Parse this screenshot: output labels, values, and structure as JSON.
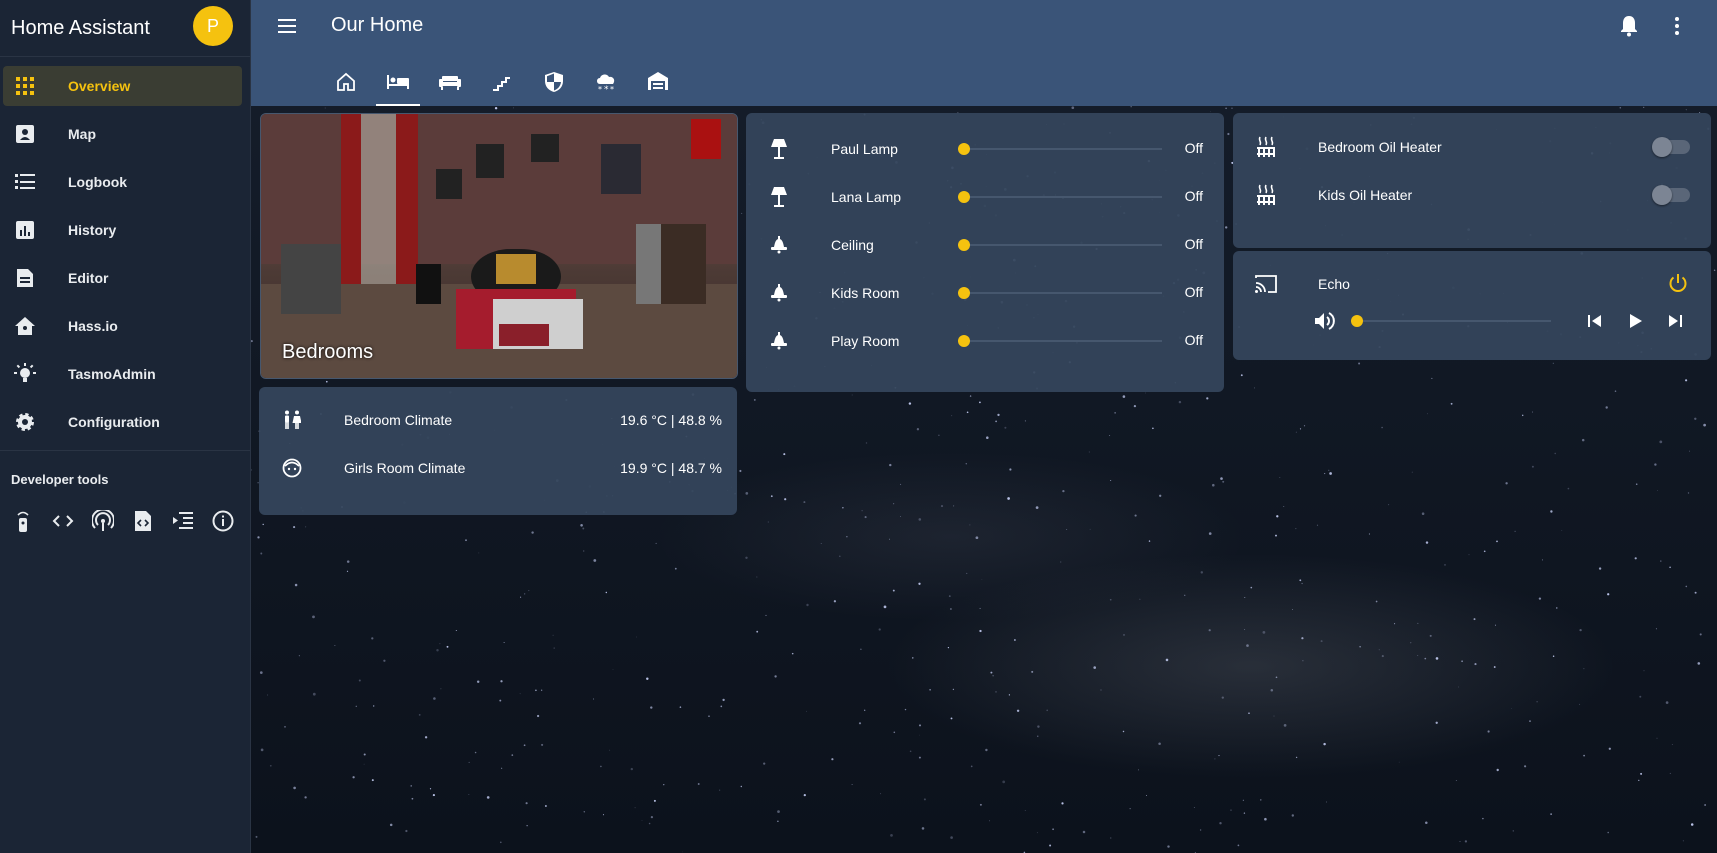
{
  "sidebar": {
    "title": "Home Assistant",
    "avatar_initial": "P",
    "items": [
      {
        "label": "Overview",
        "icon": "grid-icon",
        "active": true
      },
      {
        "label": "Map",
        "icon": "map-pin-icon"
      },
      {
        "label": "Logbook",
        "icon": "list-icon"
      },
      {
        "label": "History",
        "icon": "chart-icon"
      },
      {
        "label": "Editor",
        "icon": "document-icon"
      },
      {
        "label": "Hass.io",
        "icon": "home-assistant-icon"
      },
      {
        "label": "TasmoAdmin",
        "icon": "lightbulb-icon"
      },
      {
        "label": "Configuration",
        "icon": "gear-icon"
      }
    ],
    "dev_tools_title": "Developer tools",
    "dev_tools": [
      "remote-icon",
      "code-icon",
      "broadcast-icon",
      "file-code-icon",
      "template-icon",
      "info-icon"
    ]
  },
  "header": {
    "title": "Our Home",
    "tabs": [
      "home-icon",
      "bed-icon",
      "sofa-icon",
      "stairs-icon",
      "shield-icon",
      "weather-snow-icon",
      "garage-icon"
    ],
    "active_tab": 1
  },
  "picture_card": {
    "caption": "Bedrooms"
  },
  "climate_card": {
    "rows": [
      {
        "name": "Bedroom Climate",
        "value": "19.6 °C | 48.8 %",
        "icon": "human-male-female-icon"
      },
      {
        "name": "Girls Room Climate",
        "value": "19.9 °C | 48.7 %",
        "icon": "face-icon"
      }
    ]
  },
  "lights_card": {
    "rows": [
      {
        "name": "Paul Lamp",
        "state": "Off",
        "icon": "floor-lamp-icon",
        "brightness": 0
      },
      {
        "name": "Lana Lamp",
        "state": "Off",
        "icon": "floor-lamp-icon",
        "brightness": 0
      },
      {
        "name": "Ceiling",
        "state": "Off",
        "icon": "ceiling-light-icon",
        "brightness": 0
      },
      {
        "name": "Kids Room",
        "state": "Off",
        "icon": "ceiling-light-icon",
        "brightness": 0
      },
      {
        "name": "Play Room",
        "state": "Off",
        "icon": "ceiling-light-icon",
        "brightness": 0
      }
    ]
  },
  "heaters_card": {
    "rows": [
      {
        "name": "Bedroom Oil Heater",
        "icon": "radiator-icon",
        "on": false
      },
      {
        "name": "Kids Oil Heater",
        "icon": "radiator-icon",
        "on": false
      }
    ]
  },
  "media_card": {
    "name": "Echo",
    "icon": "cast-icon",
    "volume": 0,
    "controls": [
      "volume-icon",
      "skip-previous-icon",
      "play-icon",
      "skip-next-icon",
      "power-icon"
    ]
  },
  "colors": {
    "accent": "#f5c20f",
    "header": "#3a5478",
    "sidebar": "#1b2535",
    "card": "#34455b"
  }
}
